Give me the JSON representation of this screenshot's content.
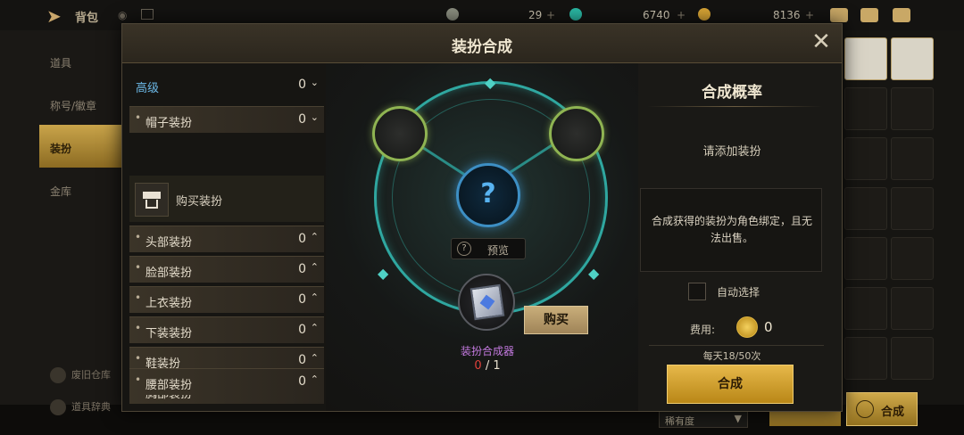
{
  "topbar": {
    "title": "背包",
    "currency1": "29",
    "currency2": "6740",
    "currency3": "8136"
  },
  "bg_nav": {
    "items": [
      "道具",
      "称号/徽章",
      "装扮",
      "金库"
    ],
    "bottom": [
      "废旧仓库",
      "道具辞典"
    ]
  },
  "bg_bottom": {
    "sort_label": "稀有度",
    "synth_label": "合成"
  },
  "modal": {
    "title": "装扮合成",
    "close": "✕"
  },
  "categories": {
    "top": {
      "label": "高级",
      "count": "0"
    },
    "hat": {
      "label": "帽子装扮",
      "count": "0"
    },
    "buy": "购买装扮",
    "items": [
      {
        "label": "头部装扮",
        "count": "0"
      },
      {
        "label": "脸部装扮",
        "count": "0"
      },
      {
        "label": "上衣装扮",
        "count": "0"
      },
      {
        "label": "下装装扮",
        "count": "0"
      },
      {
        "label": "鞋装扮",
        "count": "0"
      },
      {
        "label": "胸部装扮",
        "count": "0"
      },
      {
        "label": "腰部装扮",
        "count": "0"
      }
    ]
  },
  "synthesis": {
    "center_symbol": "?",
    "preview": "预览",
    "buy": "购买",
    "item_name": "装扮合成器",
    "owned": "0",
    "required": "/ 1"
  },
  "rate_panel": {
    "title": "合成概率",
    "hint": "请添加装扮",
    "notice": "合成获得的装扮为角色绑定，且无法出售。",
    "auto_select": "自动选择",
    "fee_label": "费用:",
    "fee_value": "0",
    "daily": "每天18/50次",
    "synth_button": "合成"
  },
  "colors": {
    "accent_gold": "#e6b84a",
    "ring_teal": "#2fa7a0",
    "item_purple": "#c47ae0",
    "count_red": "#e0413b",
    "tier_blue": "#6cb8e6"
  }
}
